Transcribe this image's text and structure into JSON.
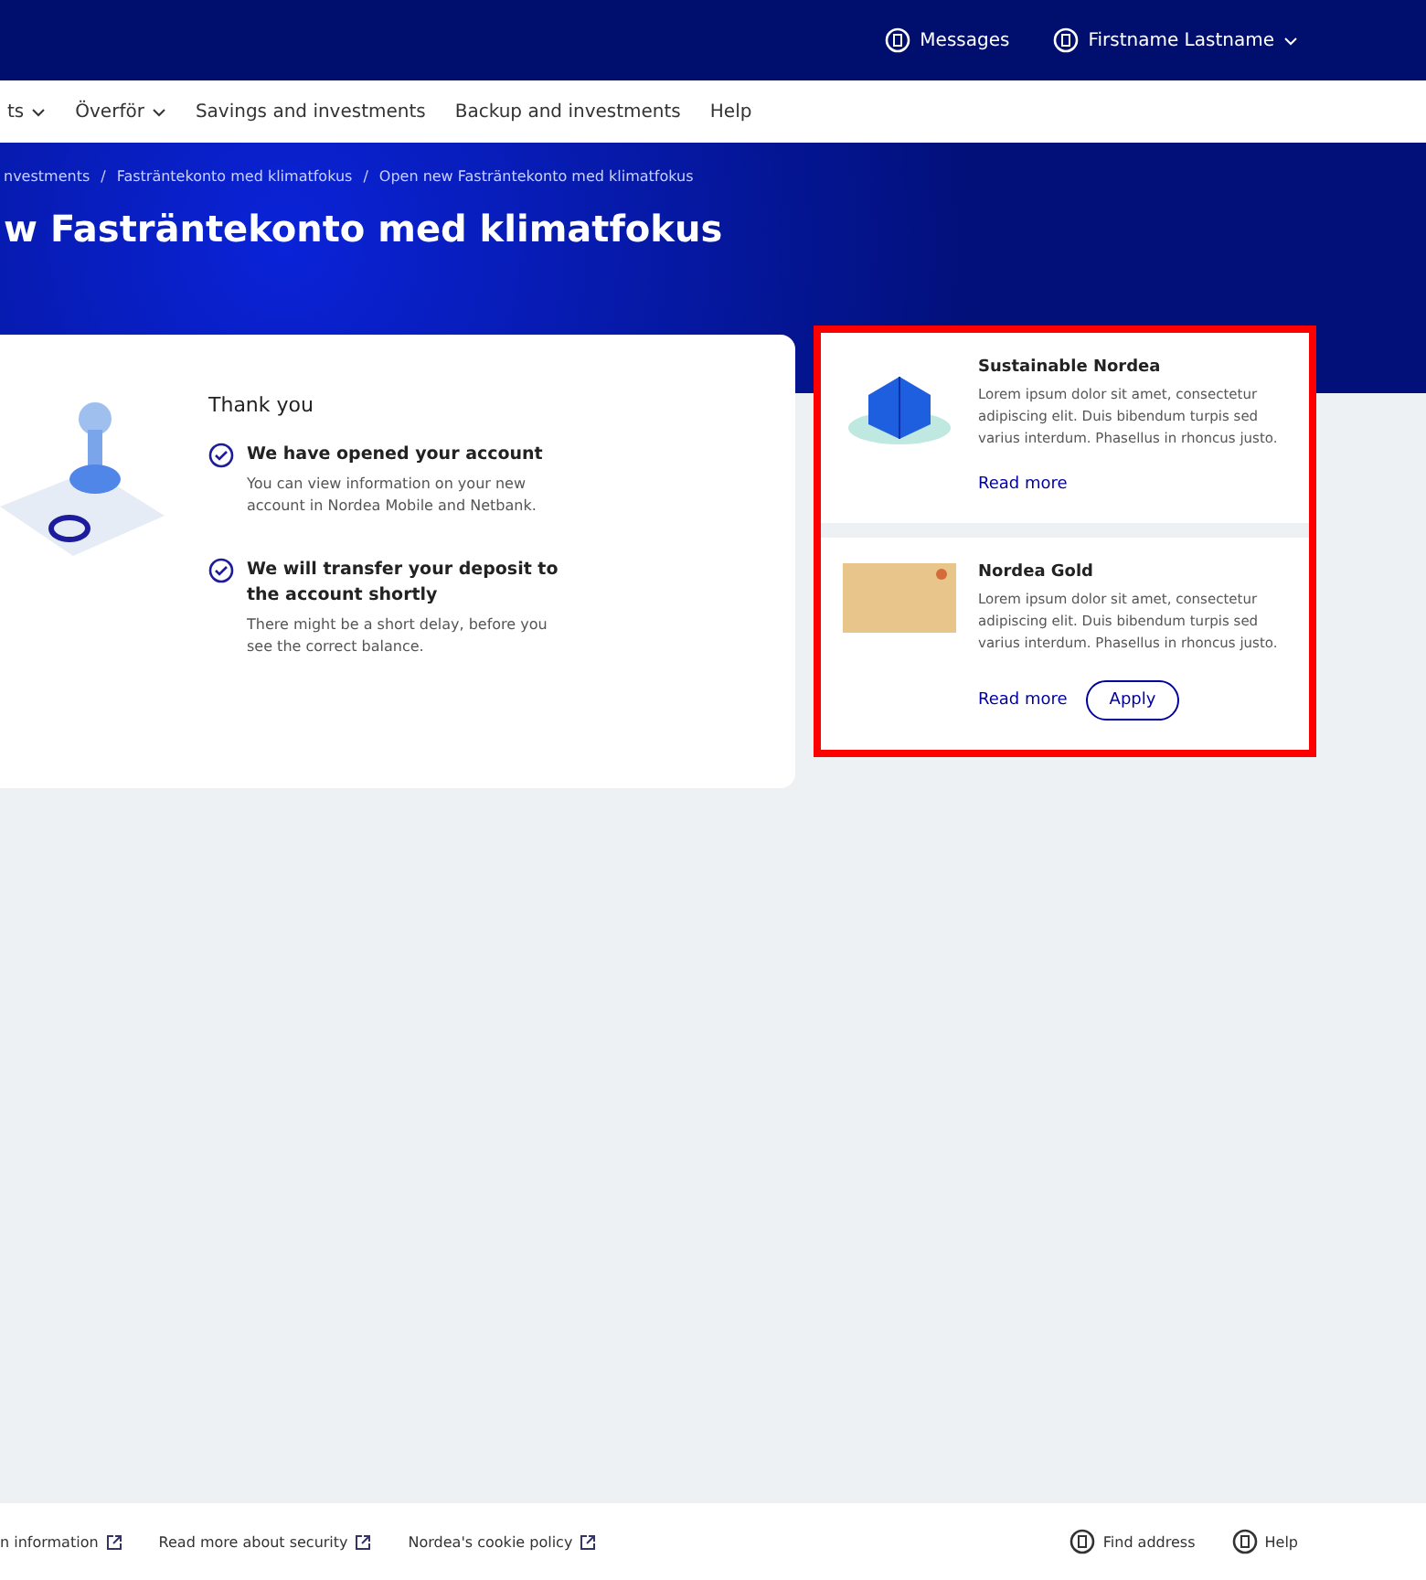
{
  "top_bar": {
    "messages": "Messages",
    "user": "Firstname Lastname"
  },
  "nav": [
    {
      "label": "ts",
      "dropdown": true
    },
    {
      "label": "Överför",
      "dropdown": true
    },
    {
      "label": "Savings and investments",
      "dropdown": false
    },
    {
      "label": "Backup and investments",
      "dropdown": false
    },
    {
      "label": "Help",
      "dropdown": false
    }
  ],
  "breadcrumb_separator": "/",
  "breadcrumb": [
    "nvestments",
    "Fasträntekonto med klimatfokus",
    "Open new Fasträntekonto med klimatfokus"
  ],
  "title": "w Fasträntekonto med klimatfokus",
  "confirmation": {
    "heading": "Thank you",
    "steps": [
      {
        "title": "We have opened your account",
        "text": "You can view information on your new account in Nordea Mobile and Netbank."
      },
      {
        "title": "We will transfer your deposit to the account shortly",
        "text": "There might be a short delay, before you see the correct balance."
      }
    ]
  },
  "promos": {
    "highlighted": true,
    "items": [
      {
        "kind": "sustainability",
        "title": "Sustainable Nordea",
        "text": "Lorem ipsum dolor sit amet, consectetur adipiscing elit. Duis bibendum turpis sed varius interdum. Phasellus in rhoncus justo.",
        "link": "Read more"
      },
      {
        "kind": "card",
        "title": "Nordea Gold",
        "text": "Lorem ipsum dolor sit amet, consectetur adipiscing elit. Duis bibendum turpis sed varius interdum. Phasellus in rhoncus justo.",
        "link": "Read more",
        "button": "Apply"
      }
    ]
  },
  "footer": {
    "links": [
      "n information",
      "Read more about security",
      "Nordea's cookie policy"
    ],
    "actions": [
      "Find address",
      "Help"
    ]
  }
}
